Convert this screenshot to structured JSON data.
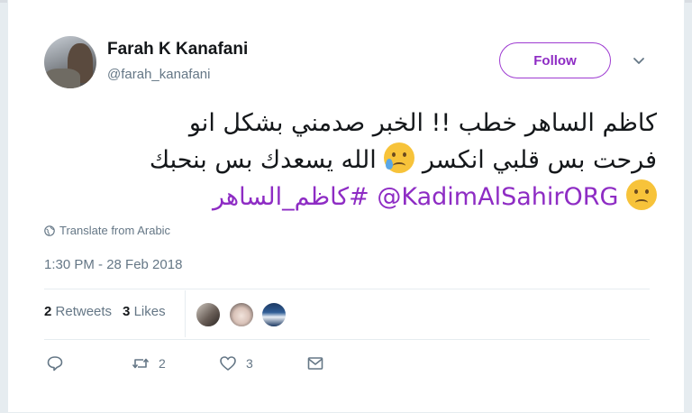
{
  "tweet": {
    "author_name": "Farah K Kanafani",
    "author_handle": "@farah_kanafani",
    "follow_label": "Follow",
    "text_line1": "كاظم الساهر خطب !! الخبر صدمني  بشكل انو",
    "text_line2_a": "فرحت بس قلبي انكسر",
    "text_line2_b": "الله يسعدك بس بنحبك",
    "mention": "@KadimAlSahirORG",
    "hashtag": "#كاظم_الساهر",
    "emoji_1": "crying-face-emoji",
    "emoji_2": "frowning-face-emoji",
    "translate_label": "Translate from Arabic",
    "timestamp": "1:30 PM - 28 Feb 2018"
  },
  "stats": {
    "retweets_count": "2",
    "retweets_label": "Retweets",
    "likes_count": "3",
    "likes_label": "Likes"
  },
  "actions": {
    "reply_count": "",
    "retweet_count": "2",
    "like_count": "3"
  },
  "colors": {
    "accent": "#8e2cc4",
    "secondary_text": "#657786",
    "border": "#e6ecf0"
  }
}
